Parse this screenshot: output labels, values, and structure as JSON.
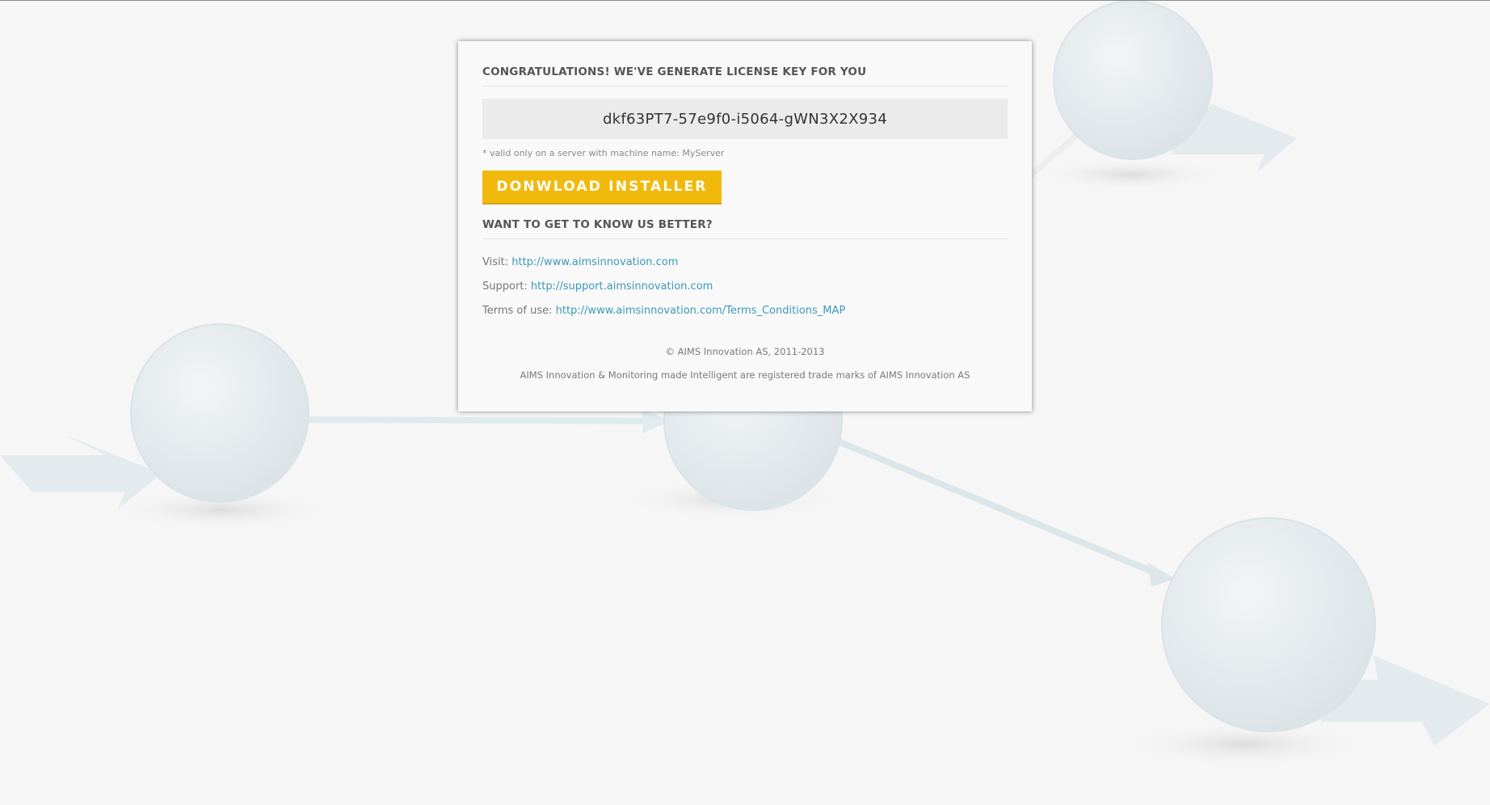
{
  "card": {
    "heading": "CONGRATULATIONS! WE'VE GENERATE LICENSE KEY FOR YOU",
    "license_key": "dkf63PT7-57e9f0-i5064-gWN3X2X934",
    "valid_note": "* valid only on a server with machine name: MyServer",
    "download_button": "DONWLOAD INSTALLER",
    "know_us_heading": "WANT TO GET TO KNOW US BETTER?",
    "links": [
      {
        "label": "Visit:",
        "url": "http://www.aimsinnovation.com"
      },
      {
        "label": "Support:",
        "url": "http://support.aimsinnovation.com"
      },
      {
        "label": "Terms of use:",
        "url": "http://www.aimsinnovation.com/Terms_Conditions_MAP"
      }
    ],
    "copyright": "© AIMS Innovation AS, 2011-2013",
    "trademark": "AIMS Innovation & Monitoring made Intelligent are registered trade marks of AIMS Innovation AS"
  },
  "colors": {
    "accent": "#f2b90d",
    "link": "#3b9ab8",
    "background": "#f6f6f6",
    "key_box": "#ebebeb"
  }
}
